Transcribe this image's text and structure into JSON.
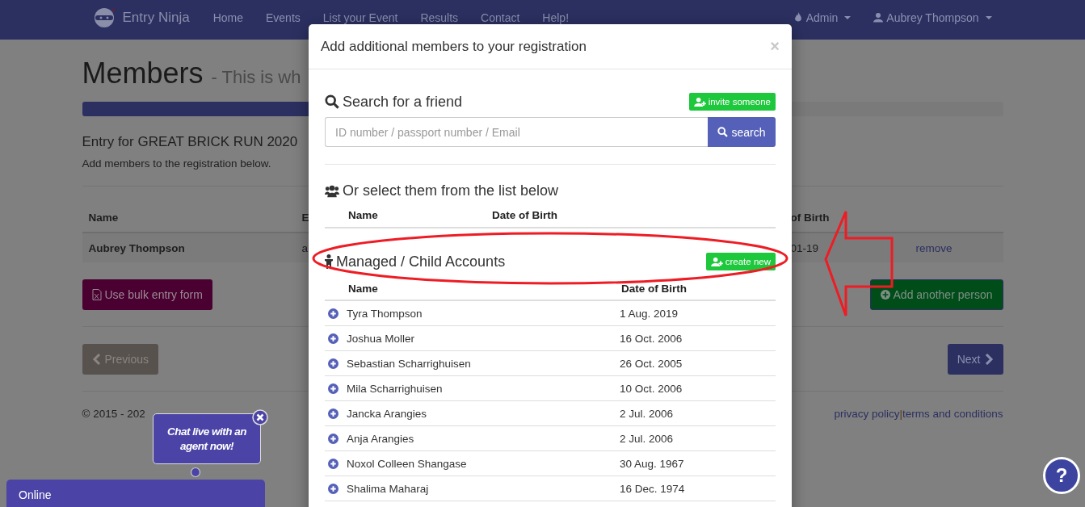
{
  "nav": {
    "brand": "Entry Ninja",
    "links": [
      "Home",
      "Events",
      "List your Event",
      "Results",
      "Contact",
      "Help!"
    ],
    "admin_menu": "Admin",
    "user_menu": "Aubrey Thompson"
  },
  "page": {
    "title": "Members",
    "subtitle": "- This is wh",
    "progress": {
      "level": 0.5
    },
    "entry_title": "Entry for GREAT BRICK RUN 2020",
    "instructions": "Add members to the registration below.",
    "table": {
      "columns": [
        "Name",
        "E",
        "of Birth"
      ],
      "rows": [
        {
          "cells": [
            "Aubrey Thompson",
            "a",
            "01-19"
          ],
          "action": "remove"
        }
      ]
    },
    "bulk_button": "Use bulk entry form",
    "add_button": "Add another person",
    "previous_button": "Previous",
    "next_button": "Next",
    "copyright": "© 2015 - 202",
    "footer_links": [
      "privacy policy",
      "terms and conditions"
    ],
    "footer_separator": "|"
  },
  "modal": {
    "title": "Add additional members to your registration",
    "close": "×",
    "search": {
      "heading": "Search for a friend",
      "invite_button": "invite someone",
      "placeholder": "ID number / passport number / Email",
      "button": "search"
    },
    "friends": {
      "heading": "Or select them from the list below",
      "columns": [
        "Name",
        "Date of Birth"
      ]
    },
    "managed": {
      "heading": "Managed / Child Accounts",
      "create_button": "create new",
      "columns": [
        "Name",
        "Date of Birth"
      ],
      "rows": [
        {
          "name": "Tyra Thompson",
          "dob": "1 Aug. 2019"
        },
        {
          "name": "Joshua Moller",
          "dob": "16 Oct. 2006"
        },
        {
          "name": "Sebastian Scharrighuisen",
          "dob": "26 Oct. 2005"
        },
        {
          "name": "Mila Scharrighuisen",
          "dob": "10 Oct. 2006"
        },
        {
          "name": "Jancka Arangies",
          "dob": "2 Jul. 2006"
        },
        {
          "name": "Anja Arangies",
          "dob": "2 Jul. 2006"
        },
        {
          "name": "Noxol Colleen Shangase",
          "dob": "30 Aug. 1967"
        },
        {
          "name": "Shalima Maharaj",
          "dob": "16 Dec. 1974"
        }
      ]
    }
  },
  "chat": {
    "bubble": "Chat live with an agent now!",
    "status": "Online"
  },
  "help": "?"
}
